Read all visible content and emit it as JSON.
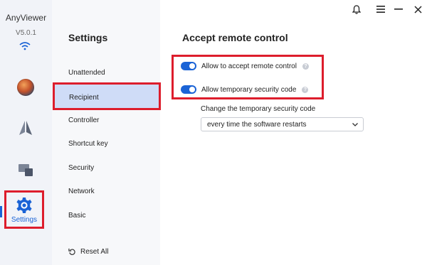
{
  "app": {
    "name": "AnyViewer",
    "version": "V5.0.1"
  },
  "titlebar": {
    "icons": [
      "bell-icon",
      "menu-icon",
      "minimize-icon",
      "close-icon"
    ]
  },
  "rail": {
    "items": [
      {
        "icon": "avatar"
      },
      {
        "icon": "remote-control-icon"
      },
      {
        "icon": "devices-icon"
      },
      {
        "icon": "gear-icon",
        "label": "Settings",
        "selected": true
      }
    ]
  },
  "settings": {
    "title": "Settings",
    "items": [
      "Unattended",
      "Recipient",
      "Controller",
      "Shortcut key",
      "Security",
      "Network",
      "Basic"
    ],
    "selected": "Recipient",
    "reset_label": "Reset All"
  },
  "content": {
    "title": "Accept remote control",
    "toggles": [
      {
        "label": "Allow to accept remote control",
        "on": true
      },
      {
        "label": "Allow temporary security code",
        "on": true
      }
    ],
    "security_code_label": "Change the temporary security code",
    "security_code_select": "every time the software restarts"
  },
  "colors": {
    "accent": "#1a63d6",
    "highlight": "#dd1d2c",
    "selected_bg": "#cfdcf7"
  }
}
